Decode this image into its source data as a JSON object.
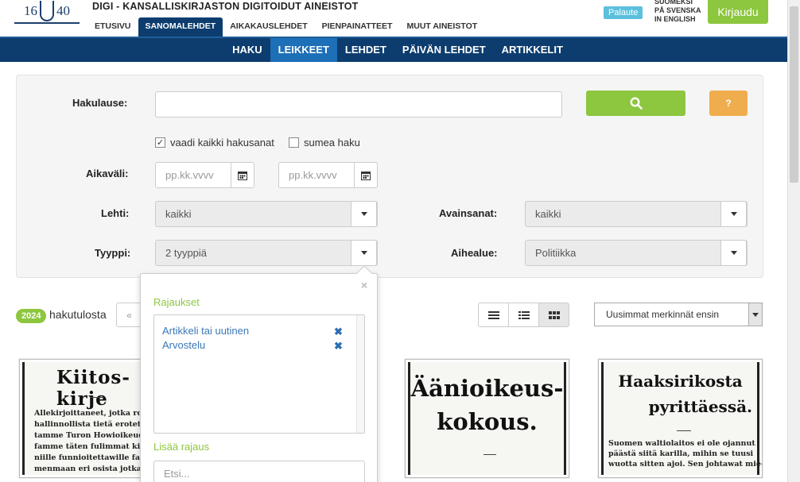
{
  "header": {
    "logo_left": "16",
    "logo_right": "40",
    "site_title": "DIGI - KANSALLISKIRJASTON DIGITOIDUT AINEISTOT",
    "main_nav": [
      "ETUSIVU",
      "SANOMALEHDET",
      "AIKAKAUSLEHDET",
      "PIENPAINATTEET",
      "MUUT AINEISTOT"
    ],
    "main_nav_active": "SANOMALEHDET",
    "feedback_label": "Palaute",
    "languages": [
      "SUOMEKSI",
      "PÅ SVENSKA",
      "IN ENGLISH"
    ],
    "login_label": "Kirjaudu"
  },
  "subnav": {
    "items": [
      "HAKU",
      "LEIKKEET",
      "LEHDET",
      "PÄIVÄN LEHDET",
      "ARTIKKELIT"
    ],
    "active": "LEIKKEET"
  },
  "search": {
    "query_label": "Hakulause:",
    "query_value": "",
    "help_label": "?",
    "require_all_label": "vaadi kaikki hakusanat",
    "require_all_checked": true,
    "fuzzy_label": "sumea haku",
    "fuzzy_checked": false,
    "date_label": "Aikaväli:",
    "date_start_placeholder": "pp.kk.vvvv",
    "date_end_placeholder": "pp.kk.vvvv",
    "paper_label": "Lehti:",
    "paper_value": "kaikki",
    "keywords_label": "Avainsanat:",
    "keywords_value": "kaikki",
    "type_label": "Tyyppi:",
    "type_value": "2 tyyppiä",
    "subject_label": "Aihealue:",
    "subject_value": "Politiikka"
  },
  "results": {
    "count": "2024",
    "count_suffix": "hakutulosta",
    "pager_prev": "«",
    "sort_value": "Uusimmat merkinnät ensin"
  },
  "clippings": [
    {
      "headline": "Kiitos-kirje",
      "text": [
        "Allekirjoittaneet, jotka rout",
        "hallinnollista tietä erotettiin",
        "tamme Turon Howioikeuden",
        "famme täten fulimmat ki",
        "niille funnioitettawille fanfalai",
        "menmaan eri osista jotka"
      ]
    },
    {
      "headline_1": "Äänioikeus-",
      "headline_2": "kokous."
    },
    {
      "headline_1": "Haaksirikosta",
      "headline_2": "pyrittäessä.",
      "text": [
        "Suomen waltiolaitos ei ole ojannut",
        "päästä siitä karilla, mihin se tuusi",
        "wuotta sitten ajoi. Sen johtawat mie-"
      ]
    }
  ],
  "popover": {
    "close_label": "×",
    "title": "Rajaukset",
    "items": [
      "Artikkeli tai uutinen",
      "Arvostelu"
    ],
    "remove_label": "✖",
    "add_title": "Lisää rajaus",
    "add_placeholder": "Etsi..."
  },
  "colors": {
    "navy": "#0d3d6e",
    "green": "#8dc63f",
    "orange": "#f0ad4e",
    "link_blue": "#3a78b8"
  }
}
